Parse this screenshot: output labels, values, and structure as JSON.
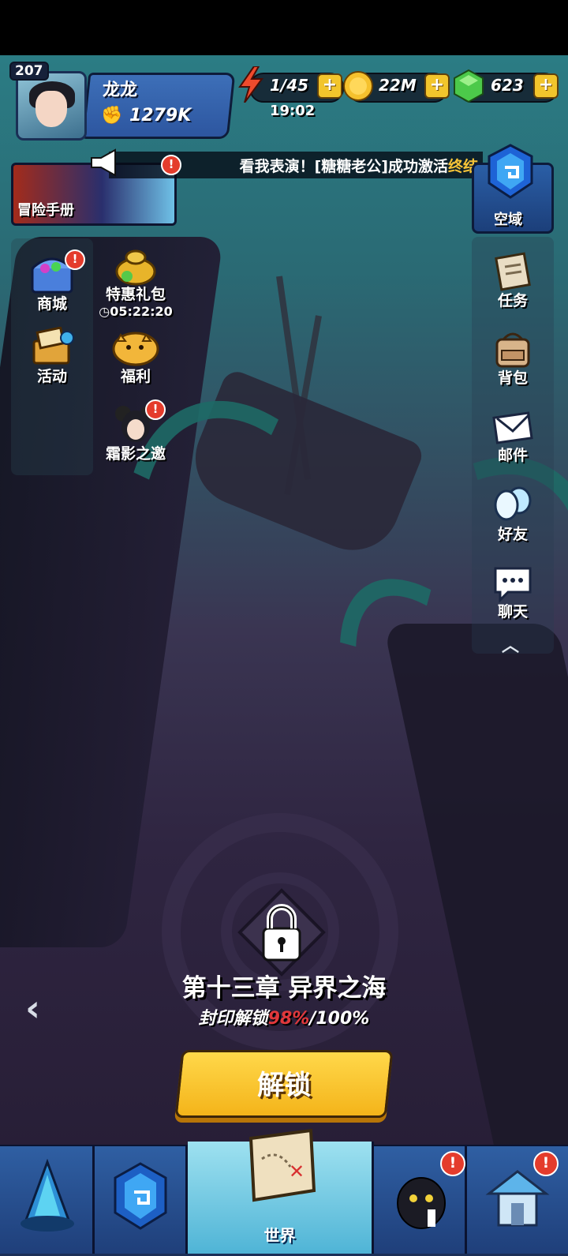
{
  "player": {
    "level": "207",
    "name": "龙龙",
    "power": "1279K"
  },
  "resources": {
    "energy": "1/45",
    "energy_timer": "19:02",
    "gold": "22M",
    "gems": "623",
    "plus_symbol": "+"
  },
  "ticker": {
    "text_main": "看我表演！[糖糖老公]成功激活",
    "text_highlight": "终结"
  },
  "handbook": {
    "label": "冒险手册",
    "badge": "!"
  },
  "sky_domain": {
    "label": "空域"
  },
  "left_menu": {
    "shop": {
      "label": "商城",
      "icon": "treasure-chest-icon",
      "badge": "!"
    },
    "gift_pack": {
      "label": "特惠礼包",
      "icon": "gold-sack-icon",
      "countdown": "05:22:20"
    },
    "events": {
      "label": "活动",
      "icon": "treasure-map-icon"
    },
    "welfare": {
      "label": "福利",
      "icon": "piggy-bank-icon"
    },
    "frost_invite": {
      "label": "霜影之邀",
      "icon": "character-portrait-icon",
      "badge": "!"
    }
  },
  "right_menu": {
    "tasks": {
      "label": "任务",
      "icon": "scroll-icon"
    },
    "bag": {
      "label": "背包",
      "icon": "backpack-icon"
    },
    "mail": {
      "label": "邮件",
      "icon": "envelope-icon"
    },
    "friends": {
      "label": "好友",
      "icon": "friends-icon"
    },
    "chat": {
      "label": "聊天",
      "icon": "chat-bubble-icon"
    }
  },
  "chapter": {
    "title": "第十三章 异界之海",
    "progress_prefix": "封印解锁",
    "progress_current": "98%",
    "progress_total": "/100%",
    "unlock_button": "解锁"
  },
  "bottom_nav": {
    "tabs": [
      {
        "icon": "crystal-spire-icon"
      },
      {
        "icon": "hex-emblem-icon"
      },
      {
        "label": "世界",
        "icon": "world-map-icon",
        "active": true
      },
      {
        "icon": "dark-creature-icon",
        "badge": "!"
      },
      {
        "icon": "house-icon",
        "badge": "!"
      }
    ]
  },
  "colors": {
    "accent_gold": "#f4b41a",
    "badge_red": "#e43c2c",
    "highlight_red": "#e2383b",
    "nav_blue": "#1f3f7a"
  }
}
